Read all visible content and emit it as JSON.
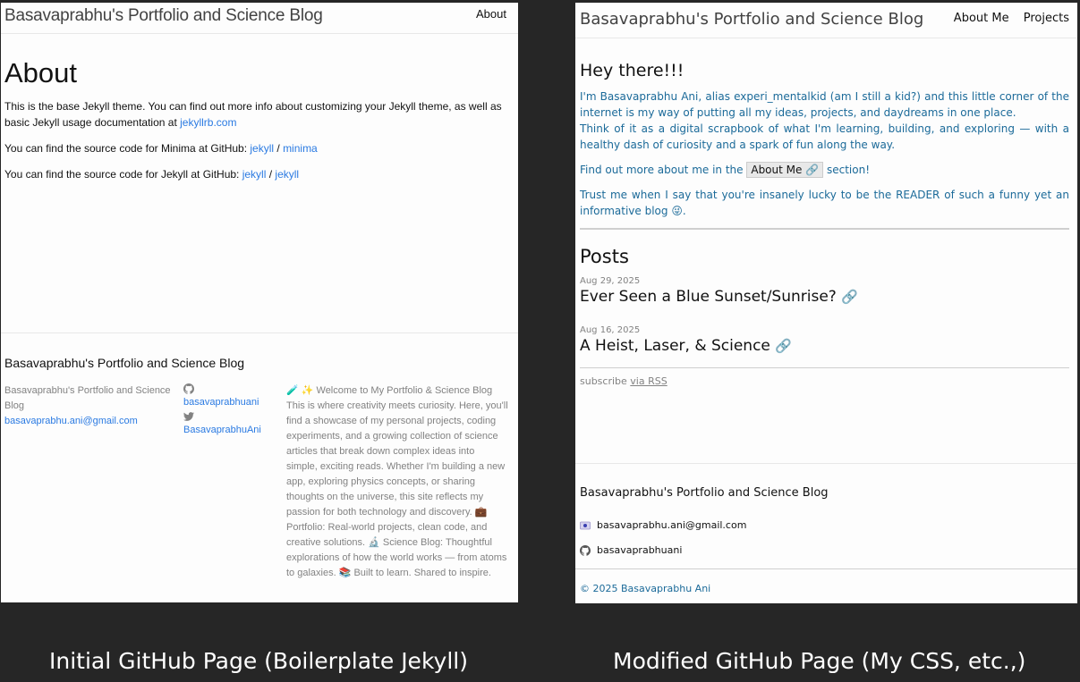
{
  "initial": {
    "site_title": "Basavaprabhu's Portfolio and Science Blog",
    "nav_about": "About",
    "heading": "About",
    "p1_text": "This is the base Jekyll theme. You can find out more info about customizing your Jekyll theme, as well as basic Jekyll usage documentation at ",
    "p1_link": "jekyllrb.com",
    "p2_text": "You can find the source code for Minima at GitHub: ",
    "p2_link1": "jekyll",
    "p2_sep": " / ",
    "p2_link2": "minima",
    "p3_text": "You can find the source code for Jekyll at GitHub: ",
    "p3_link1": "jekyll",
    "p3_sep": " / ",
    "p3_link2": "jekyll",
    "footer": {
      "title": "Basavaprabhu's Portfolio and Science Blog",
      "col1_name": "Basavaprabhu's Portfolio and Science Blog",
      "col1_email": "basavaprabhu.ani@gmail.com",
      "github_user": "basavaprabhuani",
      "twitter_user": "BasavaprabhuAni",
      "description": "🧪 ✨ Welcome to My Portfolio & Science Blog This is where creativity meets curiosity. Here, you'll find a showcase of my personal projects, coding experiments, and a growing collection of science articles that break down complex ideas into simple, exciting reads. Whether I'm building a new app, exploring physics concepts, or sharing thoughts on the universe, this site reflects my passion for both technology and discovery. 💼 Portfolio: Real-world projects, clean code, and creative solutions. 🔬 Science Blog: Thoughtful explorations of how the world works — from atoms to galaxies. 📚 Built to learn. Shared to inspire."
    }
  },
  "modified": {
    "site_title": "Basavaprabhu's Portfolio and Science Blog",
    "nav": [
      "About Me",
      "Projects"
    ],
    "greeting": "Hey there!!!",
    "intro1": "I'm Basavaprabhu Ani, alias experi_mentalkid (am I still a kid?) and this little corner of the internet is my way of putting all my ideas, projects, and daydreams in one place.",
    "intro2": "Think of it as a digital scrapbook of what I'm learning, building, and exploring — with a healthy dash of curiosity and a spark of fun along the way.",
    "find_more_prefix": "Find out more about me in the ",
    "about_button": "About Me 🔗",
    "find_more_suffix": " section!",
    "trust_text": "Trust me when I say that you're insanely lucky to be the READER of such a funny yet an informative blog 😜.",
    "posts_heading": "Posts",
    "posts": [
      {
        "date": "Aug 29, 2025",
        "title": "Ever Seen a Blue Sunset/Sunrise?"
      },
      {
        "date": "Aug 16, 2025",
        "title": "A Heist, Laser, & Science"
      }
    ],
    "link_glyph": "🔗",
    "subscribe_prefix": "subscribe ",
    "subscribe_link": "via RSS",
    "footer": {
      "title": "Basavaprabhu's Portfolio and Science Blog",
      "email": "basavaprabhu.ani@gmail.com",
      "github_user": "basavaprabhuani",
      "copyright": "© 2025 Basavaprabhu Ani"
    }
  },
  "captions": {
    "left": "Initial GitHub Page (Boilerplate Jekyll)",
    "right": "Modified GitHub Page (My CSS, etc.,)"
  }
}
